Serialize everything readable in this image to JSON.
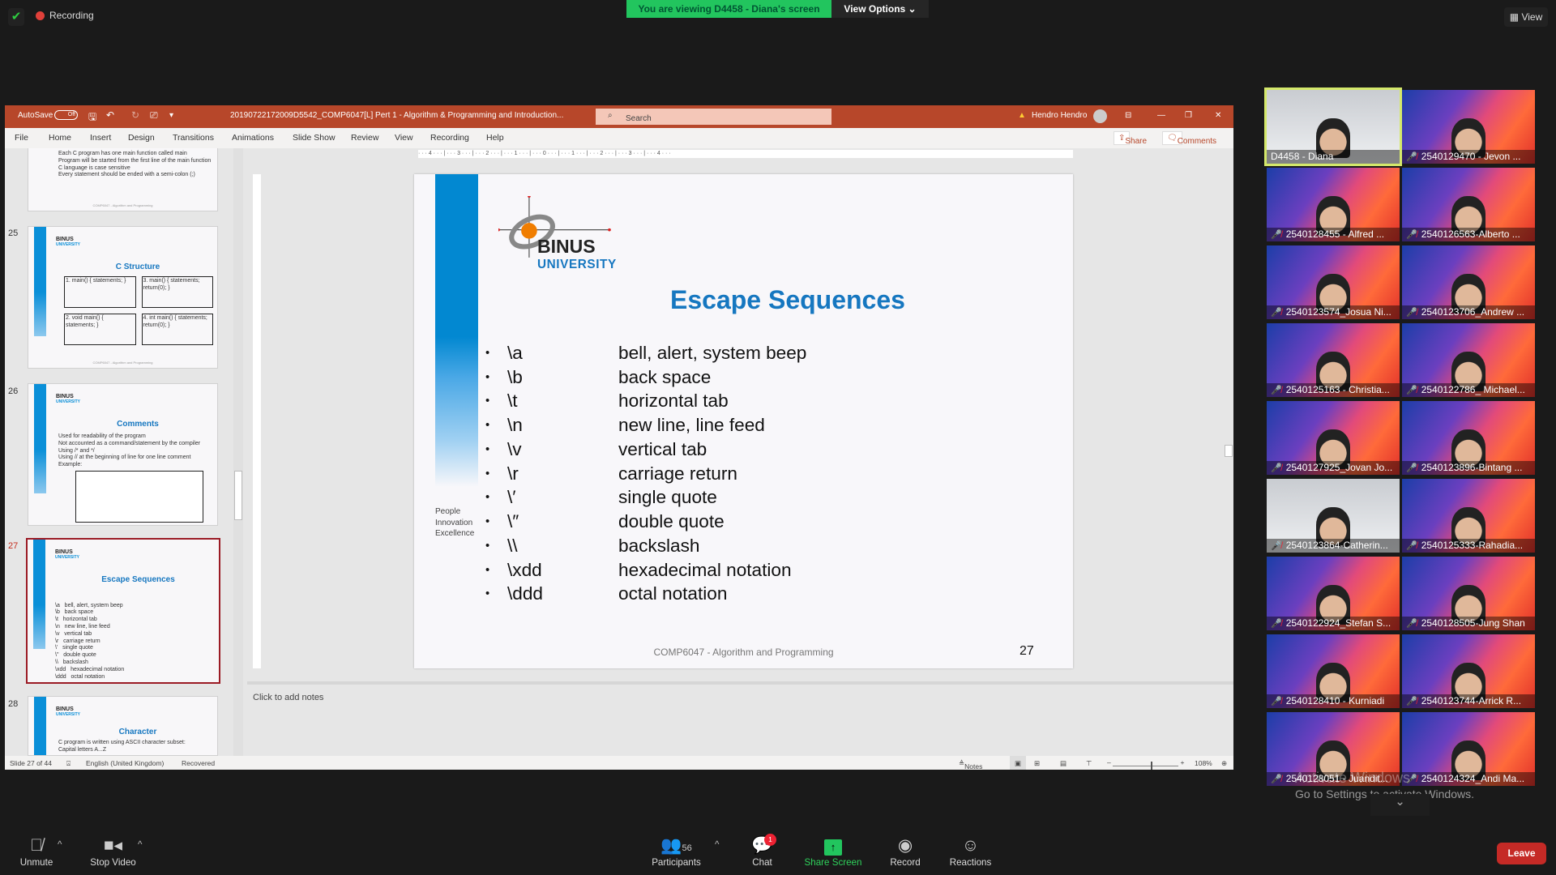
{
  "zoom": {
    "recording_label": "Recording",
    "viewing_banner": "You are viewing D4458 - Diana's screen",
    "view_options": "View Options ⌄",
    "view_button": "View"
  },
  "ppt": {
    "autosave_label": "AutoSave",
    "autosave_state": "Off",
    "filename": "20190722172009D5542_COMP6047[L] Pert 1 - Algorithm & Programming and Introduction...",
    "search_placeholder": "Search",
    "user": "Hendro Hendro",
    "menu": [
      "File",
      "Home",
      "Insert",
      "Design",
      "Transitions",
      "Animations",
      "Slide Show",
      "Review",
      "View",
      "Recording",
      "Help"
    ],
    "share": "Share",
    "comments": "Comments",
    "ruler": "· · · 4 · · · | · · · 3 · · · | · · · 2 · · · | · · · 1 · · · | · · · 0 · · · | · · · 1 · · · | · · · 2 · · · | · · · 3 · · · | · · · 4 · · ·",
    "thumbnails": [
      {
        "num": "",
        "title": "",
        "bullets": [
          "Each C program has one main function called main",
          "Program will be started from the first line of the main function",
          "C language is case sensitive",
          "Every statement should be ended with a semi-colon (;)"
        ]
      },
      {
        "num": "25",
        "title": "C Structure",
        "bullets": [
          "1. main() { statements; }",
          "2. void main() { statements; }",
          "3. main() { statements; return(0); }",
          "4. int main() { statements; return(0); }"
        ]
      },
      {
        "num": "26",
        "title": "Comments",
        "bullets": [
          "Used for readability of the program",
          "Not accounted as a command/statement by the compiler",
          "Using /* and */",
          "Using // at the beginning of line for one line comment",
          "Example:"
        ]
      },
      {
        "num": "27",
        "title": "Escape Sequences",
        "bullets": [
          "\\a   bell, alert, system beep",
          "\\b   back space",
          "\\t   horizontal tab",
          "\\n   new line, line feed",
          "\\v   vertical tab",
          "\\r   carriage return",
          "\\'   single quote",
          "\\\"   double quote",
          "\\\\   backslash",
          "\\xdd   hexadecimal notation",
          "\\ddd   octal notation"
        ]
      },
      {
        "num": "28",
        "title": "Character",
        "bullets": [
          "C program is written using ASCII character subset:",
          "Capital letters A...Z"
        ]
      }
    ],
    "thumb_footer": "COMP6047 - Algorithm and Programming",
    "slide": {
      "logo_binus": "BINUS",
      "logo_university": "UNIVERSITY",
      "tagline": [
        "People",
        "Innovation",
        "Excellence"
      ],
      "title": "Escape Sequences",
      "rows": [
        {
          "code": "\\a",
          "desc": "bell, alert, system beep"
        },
        {
          "code": "\\b",
          "desc": "back space"
        },
        {
          "code": "\\t",
          "desc": "horizontal tab"
        },
        {
          "code": "\\n",
          "desc": "new line, line feed"
        },
        {
          "code": "\\v",
          "desc": "vertical tab"
        },
        {
          "code": "\\r",
          "desc": "carriage return"
        },
        {
          "code": "\\′",
          "desc": "single quote"
        },
        {
          "code": "\\″",
          "desc": "double quote"
        },
        {
          "code": "\\\\",
          "desc": "backslash"
        },
        {
          "code": "\\xdd",
          "desc": "hexadecimal notation"
        },
        {
          "code": "\\ddd",
          "desc": "octal notation"
        }
      ],
      "footer": "COMP6047 - Algorithm and Programming",
      "number": "27"
    },
    "notes_placeholder": "Click to add notes",
    "status": {
      "slide": "Slide 27 of 44",
      "language": "English (United Kingdom)",
      "state": "Recovered",
      "notes": "Notes",
      "zoom": "108%"
    }
  },
  "participants": [
    {
      "name": "D4458 - Diana",
      "muted": false,
      "camera": true
    },
    {
      "name": "2540129470 - Jevon ...",
      "muted": true
    },
    {
      "name": "2540128455 - Alfred ...",
      "muted": true
    },
    {
      "name": "2540126563-Alberto ...",
      "muted": true
    },
    {
      "name": "2540123574_Josua Ni...",
      "muted": true
    },
    {
      "name": "2540123706_Andrew ...",
      "muted": true
    },
    {
      "name": "2540125163 - Christia...",
      "muted": true
    },
    {
      "name": "2540122786_ Michael...",
      "muted": true
    },
    {
      "name": "2540127925_Jovan Jo...",
      "muted": true
    },
    {
      "name": "2540123896-Bintang ...",
      "muted": true
    },
    {
      "name": "2540123864-Catherin...",
      "muted": true,
      "camera": true
    },
    {
      "name": "2540125333-Rahadia...",
      "muted": true
    },
    {
      "name": "2540122924_Stefan S...",
      "muted": true
    },
    {
      "name": "2540128505-Jung Shan",
      "muted": true
    },
    {
      "name": "2540128410 - Kurniadi",
      "muted": true
    },
    {
      "name": "2540123744-Arrick R...",
      "muted": true
    },
    {
      "name": "2540128051 - Juandit...",
      "muted": true
    },
    {
      "name": "2540124324_Andi Ma...",
      "muted": true
    }
  ],
  "windows_watermark": {
    "line1": "Activate Windows",
    "line2": "Go to Settings to activate Windows."
  },
  "toolbar": {
    "unmute": "Unmute",
    "stop_video": "Stop Video",
    "participants": "Participants",
    "participant_count": "56",
    "chat": "Chat",
    "chat_badge": "1",
    "share_screen": "Share Screen",
    "record": "Record",
    "reactions": "Reactions",
    "leave": "Leave"
  },
  "colors": {
    "ppt_brand": "#b7472a",
    "slide_blue": "#1677c0",
    "share_green": "#22c55e",
    "leave_red": "#c52a26",
    "active_speaker": "#d4e86a"
  }
}
